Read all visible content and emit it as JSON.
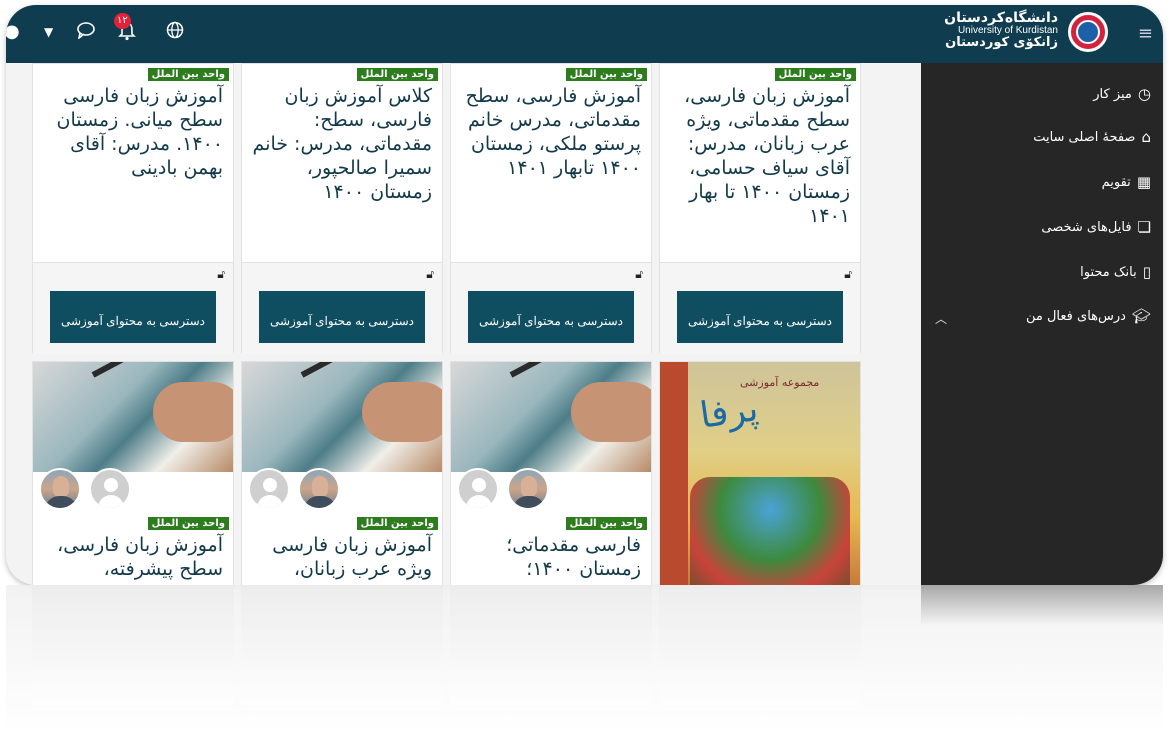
{
  "header": {
    "brand_fa": "دانشگاه‌کردستان",
    "brand_en": "University of Kurdistan",
    "brand_ku": "زانكۆی كوردستان",
    "notification_count": "۱۲"
  },
  "sidebar": {
    "items": [
      {
        "label": "میز کار",
        "icon": "dashboard-icon"
      },
      {
        "label": "صفحهٔ اصلی سایت",
        "icon": "home-icon"
      },
      {
        "label": "تقویم",
        "icon": "calendar-icon"
      },
      {
        "label": "فایل‌های شخصی",
        "icon": "file-icon"
      },
      {
        "label": "بانک محتوا",
        "icon": "clipboard-icon"
      },
      {
        "label": "درس‌های فعال من",
        "icon": "graduation-cap-icon"
      }
    ]
  },
  "courses_row1": [
    {
      "tag": "واحد بین الملل",
      "title": "آموزش زبان فارسی، سطح مقدماتی، ویژه عرب زبانان، مدرس: آقای سیاف حسامی، زمستان ۱۴۰۰ تا بهار ۱۴۰۱",
      "button": "دسترسی به محتوای آموزشی"
    },
    {
      "tag": "واحد بین الملل",
      "title": "آموزش فارسی، سطح مقدماتی، مدرس خانم پرستو ملکی، زمستان ۱۴۰۰ تابهار ۱۴۰۱",
      "button": "دسترسی به محتوای آموزشی"
    },
    {
      "tag": "واحد بین الملل",
      "title": "کلاس آموزش زبان فارسی، سطح: مقدماتی، مدرس: خانم سمیرا صالحپور، زمستان ۱۴۰۰",
      "button": "دسترسی به محتوای آموزشی"
    },
    {
      "tag": "واحد بین الملل",
      "title": "آموزش زبان فارسی سطح میانی. زمستان ۱۴۰۰. مدرس: آقای بهمن بادینی",
      "button": "دسترسی به محتوای آموزشی"
    }
  ],
  "courses_row2": [
    {
      "book_text": "پرفا",
      "book_sub": "مجموعه آموزشی"
    },
    {
      "tag": "واحد بین الملل",
      "title": "فارسی مقدماتی؛ زمستان ۱۴۰۰؛"
    },
    {
      "tag": "واحد بین الملل",
      "title": "آموزش زبان فارسی ویژه عرب زبانان،"
    },
    {
      "tag": "واحد بین الملل",
      "title": "آموزش زبان فارسی، سطح پیشرفته،"
    }
  ]
}
